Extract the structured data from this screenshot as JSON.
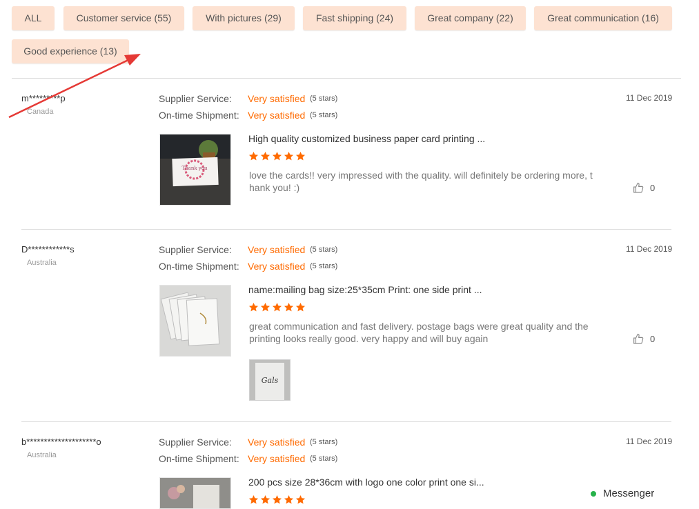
{
  "filters": [
    {
      "label": "ALL"
    },
    {
      "label": "Customer service (55)"
    },
    {
      "label": "With pictures (29)"
    },
    {
      "label": "Fast shipping (24)"
    },
    {
      "label": "Great company (22)"
    },
    {
      "label": "Great communication (16)"
    },
    {
      "label": "Good experience (13)"
    }
  ],
  "labels": {
    "supplier_service": "Supplier Service:",
    "ontime_shipment": "On-time Shipment:"
  },
  "reviews": [
    {
      "user": "m*********p",
      "country": "Canada",
      "date": "11 Dec 2019",
      "supplier_rating": "Very satisfied",
      "supplier_stars": "(5 stars)",
      "shipment_rating": "Very satisfied",
      "shipment_stars": "(5 stars)",
      "product_title": "High quality customized business paper card printing ...",
      "rating": 5,
      "text": "love the cards!! very impressed with the quality. will definitely be ordering more, thank you! :)",
      "likes": "0",
      "thumb_text": "Thank you"
    },
    {
      "user": "D************s",
      "country": "Australia",
      "date": "11 Dec 2019",
      "supplier_rating": "Very satisfied",
      "supplier_stars": "(5 stars)",
      "shipment_rating": "Very satisfied",
      "shipment_stars": "(5 stars)",
      "product_title": "name:mailing bag size:25*35cm Print: one side print ...",
      "rating": 5,
      "text": "great communication and fast delivery. postage bags were great quality and the printing looks really good. very happy and will buy again",
      "likes": "0",
      "photo_text": "Gals"
    },
    {
      "user": "b********************o",
      "country": "Australia",
      "date": "11 Dec 2019",
      "supplier_rating": "Very satisfied",
      "supplier_stars": "(5 stars)",
      "shipment_rating": "Very satisfied",
      "shipment_stars": "(5 stars)",
      "product_title": "200 pcs size 28*36cm with logo one color print one si...",
      "rating": 5
    }
  ],
  "messenger": {
    "label": "Messenger"
  },
  "colors": {
    "accent": "#ff6a00",
    "chip_bg": "#fde2d2",
    "online": "#26b24a",
    "arrow": "#e53935"
  }
}
